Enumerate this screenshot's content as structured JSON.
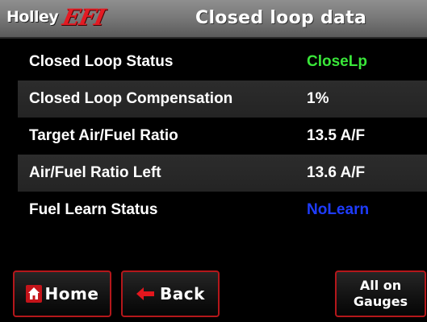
{
  "header": {
    "brand_name": "Holley",
    "brand_efi": "EFI",
    "title": "Closed loop data"
  },
  "rows": [
    {
      "label": "Closed Loop Status",
      "value": "CloseLp",
      "value_color": "#39e639"
    },
    {
      "label": "Closed Loop Compensation",
      "value": "1%",
      "value_color": "#ffffff"
    },
    {
      "label": "Target Air/Fuel Ratio",
      "value": "13.5 A/F",
      "value_color": "#ffffff"
    },
    {
      "label": "Air/Fuel Ratio Left",
      "value": "13.6 A/F",
      "value_color": "#ffffff"
    },
    {
      "label": "Fuel Learn Status",
      "value": "NoLearn",
      "value_color": "#1e3cff"
    }
  ],
  "buttons": {
    "home_label": "Home",
    "home_icon": "home-icon",
    "back_label": "Back",
    "back_icon": "left-arrow-icon",
    "gauges_line1": "All on",
    "gauges_line2": "Gauges"
  },
  "colors": {
    "accent": "#b4171b",
    "header_bg": "#7a7a7a",
    "row_alt_bg": "#2a2a2a"
  }
}
